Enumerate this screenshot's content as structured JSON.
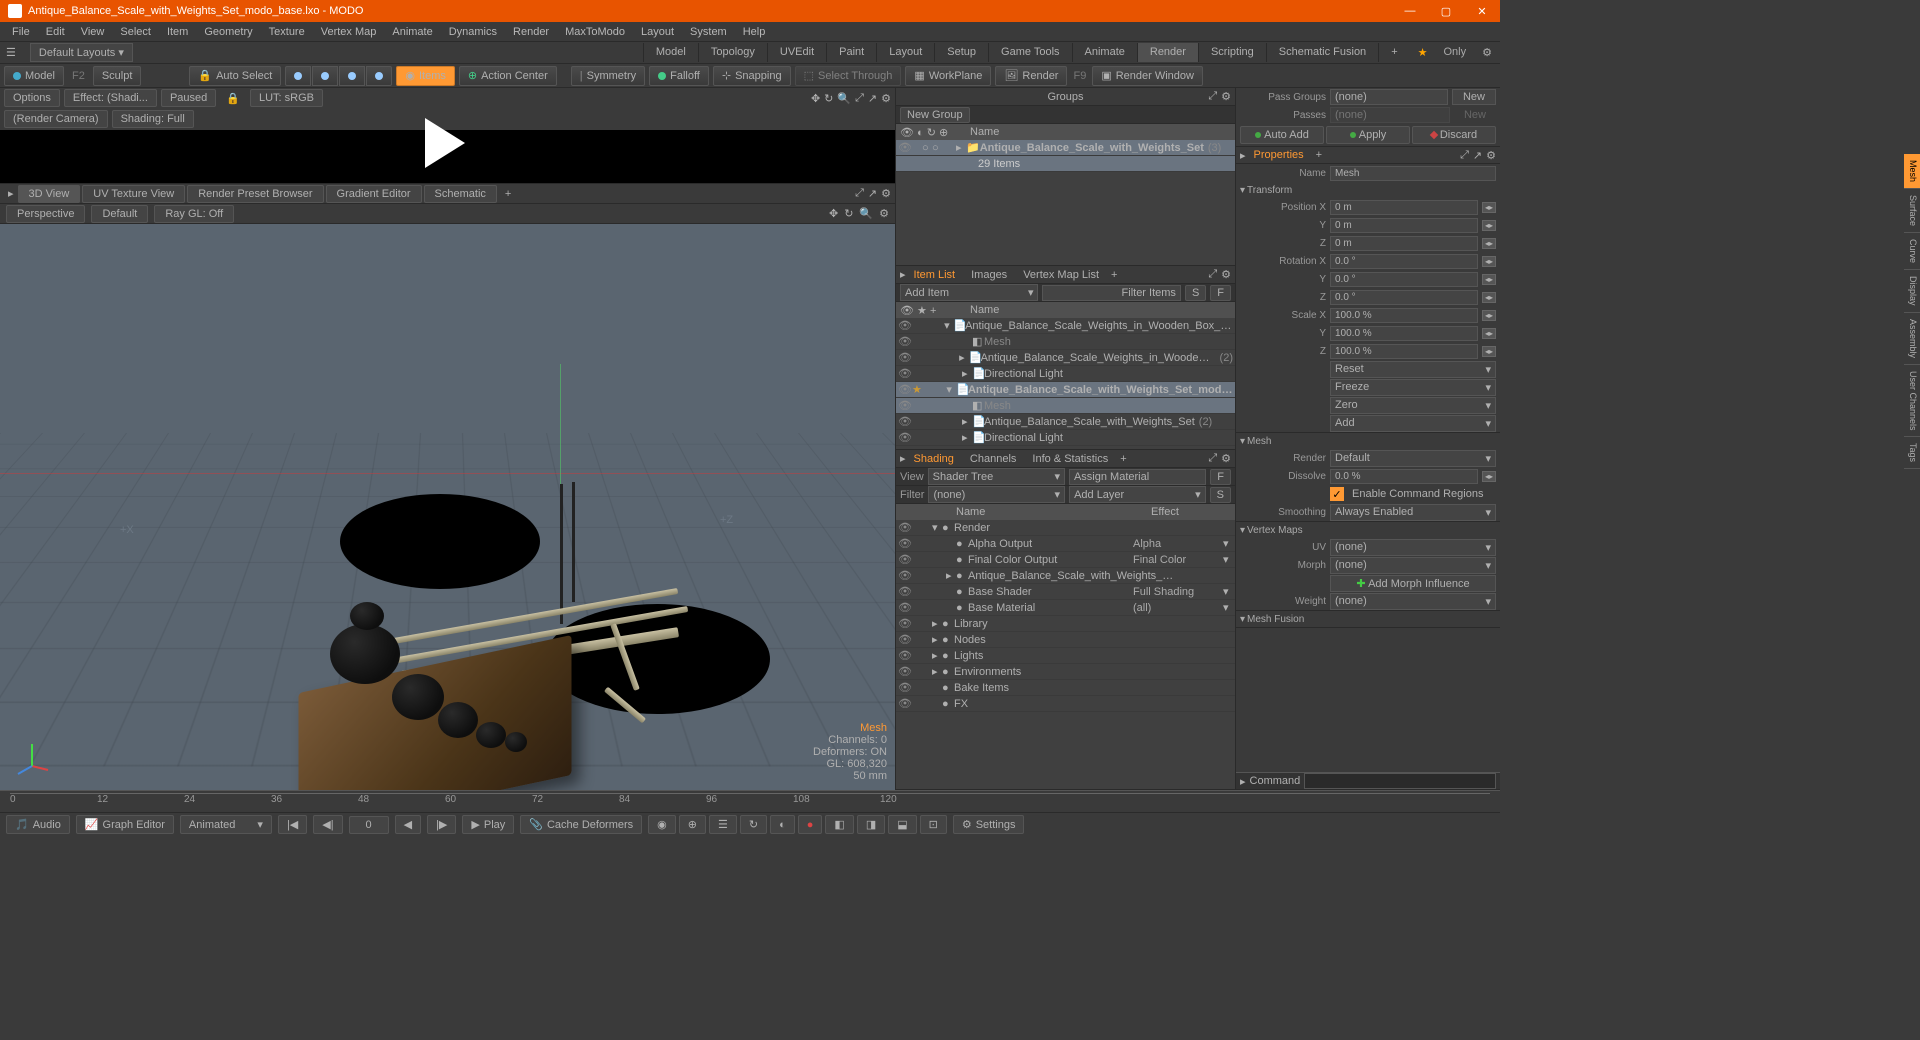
{
  "title": "Antique_Balance_Scale_with_Weights_Set_modo_base.lxo - MODO",
  "menubar": [
    "File",
    "Edit",
    "View",
    "Select",
    "Item",
    "Geometry",
    "Texture",
    "Vertex Map",
    "Animate",
    "Dynamics",
    "Render",
    "MaxToModo",
    "Layout",
    "System",
    "Help"
  ],
  "layout_dropdown": "Default Layouts ▾",
  "layout_tabs": [
    "Model",
    "Topology",
    "UVEdit",
    "Paint",
    "Layout",
    "Setup",
    "Game Tools",
    "Animate",
    "Render",
    "Scripting",
    "Schematic Fusion"
  ],
  "layout_active": "Render",
  "only_label": "Only",
  "toolbar": {
    "model": "Model",
    "model_key": "F2",
    "sculpt": "Sculpt",
    "auto_select": "Auto Select",
    "items": "Items",
    "action_center": "Action Center",
    "symmetry": "Symmetry",
    "falloff": "Falloff",
    "snapping": "Snapping",
    "select_through": "Select Through",
    "workplane": "WorkPlane",
    "render": "Render",
    "render_key": "F9",
    "render_window": "Render Window"
  },
  "preview": {
    "options": "Options",
    "effect": "Effect: (Shadi...",
    "paused": "Paused",
    "lut": "LUT: sRGB",
    "camera": "(Render Camera)",
    "shading": "Shading: Full"
  },
  "view_tabs": [
    "3D View",
    "UV Texture View",
    "Render Preset Browser",
    "Gradient Editor",
    "Schematic"
  ],
  "active_view_tab": "3D View",
  "view_opts": {
    "perspective": "Perspective",
    "default": "Default",
    "raygl": "Ray GL: Off"
  },
  "hud": {
    "mesh": "Mesh",
    "channels": "Channels: 0",
    "deformers": "Deformers: ON",
    "gl": "GL: 608,320",
    "scale": "50 mm"
  },
  "axis_labels": {
    "px": "+X",
    "pz": "+Z"
  },
  "timeline_ticks": [
    0,
    12,
    24,
    36,
    48,
    60,
    72,
    84,
    96,
    108,
    120
  ],
  "playbar": {
    "audio": "Audio",
    "graph": "Graph Editor",
    "animated": "Animated",
    "frame": "0",
    "play": "Play",
    "cache": "Cache Deformers",
    "settings": "Settings"
  },
  "groups": {
    "title": "Groups",
    "new_group": "New Group",
    "name_hdr": "Name",
    "item_name": "Antique_Balance_Scale_with_Weights_Set",
    "item_count": "(3)",
    "sub": "29 Items"
  },
  "passes": {
    "pass_groups": "Pass Groups",
    "none": "(none)",
    "new": "New",
    "passes": "Passes",
    "auto_add": "Auto Add",
    "apply": "Apply",
    "discard": "Discard"
  },
  "itemlist": {
    "tabs": [
      "Item List",
      "Images",
      "Vertex Map List"
    ],
    "active_tab": "Item List",
    "add_item": "Add Item",
    "filter": "Filter Items",
    "filter_s": "S",
    "filter_f": "F",
    "name_hdr": "Name",
    "rows": [
      {
        "ind": 1,
        "name": "Antique_Balance_Scale_Weights_in_Wooden_Box_modo_…",
        "sel": false,
        "arrow": "▾"
      },
      {
        "ind": 2,
        "name": "Mesh",
        "sel": false,
        "dim": true
      },
      {
        "ind": 2,
        "name": "Antique_Balance_Scale_Weights_in_Wooden_Box",
        "count": "(2)",
        "arrow": "▸"
      },
      {
        "ind": 2,
        "name": "Directional Light",
        "arrow": "▸"
      },
      {
        "ind": 1,
        "name": "Antique_Balance_Scale_with_Weights_Set_modo_…",
        "sel": true,
        "bold": true,
        "arrow": "▾"
      },
      {
        "ind": 2,
        "name": "Mesh",
        "sel": true,
        "dim": true
      },
      {
        "ind": 2,
        "name": "Antique_Balance_Scale_with_Weights_Set",
        "count": "(2)",
        "arrow": "▸"
      },
      {
        "ind": 2,
        "name": "Directional Light",
        "arrow": "▸"
      }
    ]
  },
  "shading": {
    "tabs": [
      "Shading",
      "Channels",
      "Info & Statistics"
    ],
    "active_tab": "Shading",
    "view": "View",
    "shader_tree": "Shader Tree",
    "assign": "Assign Material",
    "filter": "Filter",
    "none": "(none)",
    "add_layer": "Add Layer",
    "s": "S",
    "name_hdr": "Name",
    "effect_hdr": "Effect",
    "rows": [
      {
        "ind": 0,
        "name": "Render",
        "arrow": "▾",
        "icon": "globe"
      },
      {
        "ind": 1,
        "name": "Alpha Output",
        "effect": "Alpha"
      },
      {
        "ind": 1,
        "name": "Final Color Output",
        "effect": "Final Color"
      },
      {
        "ind": 1,
        "name": "Antique_Balance_Scale_with_Weights_…",
        "arrow": "▸"
      },
      {
        "ind": 1,
        "name": "Base Shader",
        "effect": "Full Shading"
      },
      {
        "ind": 1,
        "name": "Base Material",
        "effect": "(all)"
      },
      {
        "ind": 0,
        "name": "Library",
        "arrow": "▸"
      },
      {
        "ind": 0,
        "name": "Nodes",
        "arrow": "▸"
      },
      {
        "ind": 0,
        "name": "Lights",
        "arrow": "▸"
      },
      {
        "ind": 0,
        "name": "Environments",
        "arrow": "▸"
      },
      {
        "ind": 0,
        "name": "Bake Items"
      },
      {
        "ind": 0,
        "name": "FX"
      }
    ]
  },
  "properties": {
    "title": "Properties",
    "name_lbl": "Name",
    "name_val": "Mesh",
    "transform": "Transform",
    "position": "Position X",
    "pos_x": "0 m",
    "pos_y": "0 m",
    "pos_z": "0 m",
    "rotation": "Rotation X",
    "rot_x": "0.0 °",
    "rot_y": "0.0 °",
    "rot_z": "0.0 °",
    "scale": "Scale X",
    "sc_x": "100.0 %",
    "sc_y": "100.0 %",
    "sc_z": "100.0 %",
    "y": "Y",
    "z": "Z",
    "reset": "Reset",
    "freeze": "Freeze",
    "zero": "Zero",
    "add": "Add",
    "mesh": "Mesh",
    "render": "Render",
    "render_val": "Default",
    "dissolve": "Dissolve",
    "dissolve_val": "0.0 %",
    "enable_cmd": "Enable Command Regions",
    "smoothing": "Smoothing",
    "smoothing_val": "Always Enabled",
    "vertex_maps": "Vertex Maps",
    "uv": "UV",
    "none": "(none)",
    "morph": "Morph",
    "add_morph": "Add Morph Influence",
    "weight": "Weight",
    "mesh_fusion": "Mesh Fusion",
    "vtabs": [
      "Mesh",
      "Surface",
      "Curve",
      "Display",
      "Assembly",
      "User Channels",
      "Tags"
    ]
  },
  "command": "Command"
}
